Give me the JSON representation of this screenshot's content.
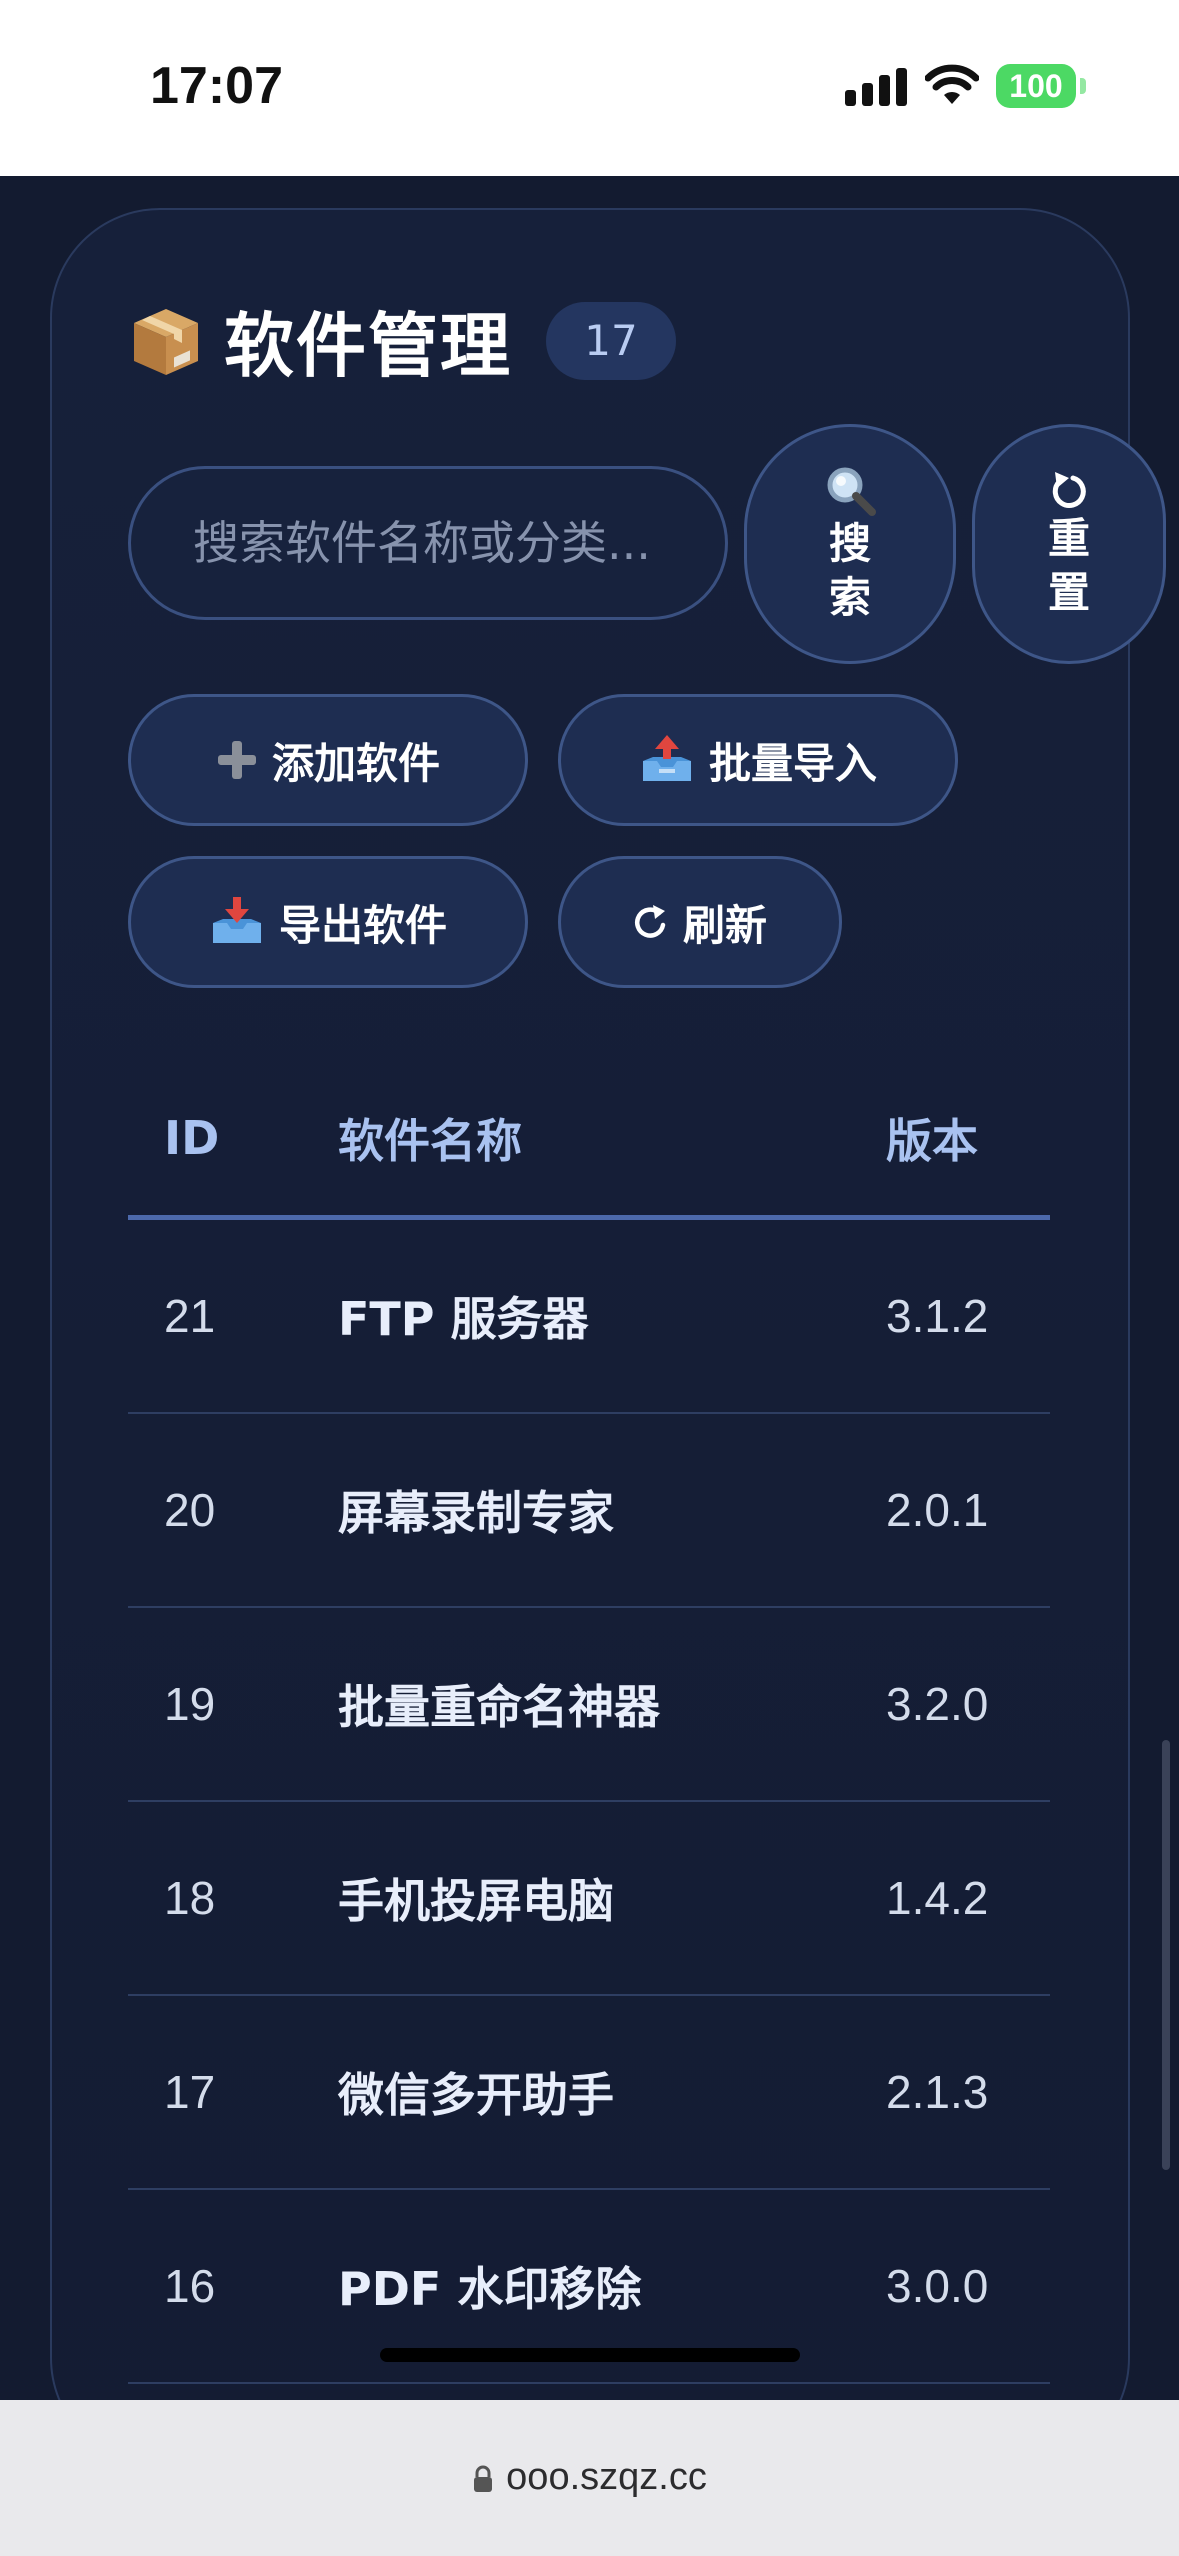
{
  "status_bar": {
    "time": "17:07",
    "battery": "100"
  },
  "header": {
    "title": "软件管理",
    "count": "17"
  },
  "search": {
    "placeholder": "搜索软件名称或分类...",
    "search_label": "搜索",
    "reset_label": "重置"
  },
  "actions": {
    "add": "添加软件",
    "import": "批量导入",
    "export": "导出软件",
    "refresh": "刷新"
  },
  "table": {
    "columns": [
      "ID",
      "软件名称",
      "版本"
    ],
    "rows": [
      {
        "id": "21",
        "name": "FTP 服务器",
        "version": "3.1.2"
      },
      {
        "id": "20",
        "name": "屏幕录制专家",
        "version": "2.0.1"
      },
      {
        "id": "19",
        "name": "批量重命名神器",
        "version": "3.2.0"
      },
      {
        "id": "18",
        "name": "手机投屏电脑",
        "version": "1.4.2"
      },
      {
        "id": "17",
        "name": "微信多开助手",
        "version": "2.1.3"
      },
      {
        "id": "16",
        "name": "PDF 水印移除",
        "version": "3.0.0"
      }
    ]
  },
  "browser": {
    "url": "ooo.szqz.cc"
  },
  "icons": {
    "title": "package-icon",
    "search": "magnifier-icon",
    "reset": "reset-icon",
    "add": "plus-icon",
    "import": "inbox-upload-icon",
    "export": "inbox-download-icon",
    "refresh": "refresh-icon"
  },
  "colors": {
    "accent": "#4c69ab",
    "background": "#131b30",
    "button": "#1e2d51"
  }
}
